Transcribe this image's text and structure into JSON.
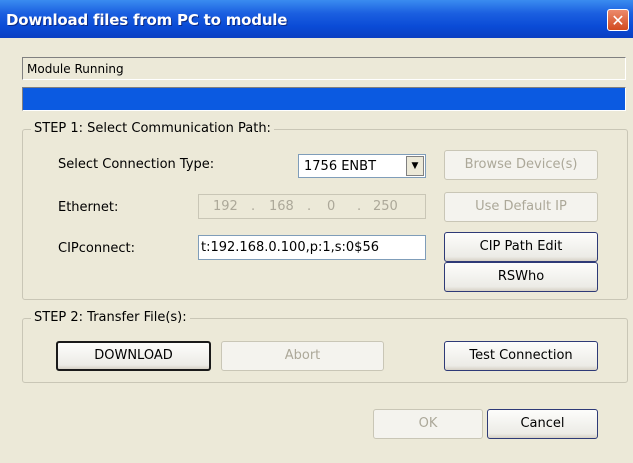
{
  "window": {
    "title": "Download files from PC to module",
    "close": "✕"
  },
  "status": {
    "text": "Module Running",
    "progress": 1.0
  },
  "step1": {
    "title": "STEP 1: Select Communication Path:",
    "connection_type_label": "Select Connection Type:",
    "connection_type_value": "1756 ENBT",
    "dropdown_arrow": "▼",
    "browse_device": "Browse Device(s)",
    "ethernet_label": "Ethernet:",
    "ip": [
      "192",
      "168",
      "0",
      "250"
    ],
    "ip_dot": ".",
    "use_default_ip": "Use Default IP",
    "cipconnect_label": "CIPconnect:",
    "cipconnect_value": "t:192.168.0.100,p:1,s:0$56",
    "cip_path_edit": "CIP Path Edit",
    "rswho": "RSWho"
  },
  "step2": {
    "title": "STEP 2: Transfer File(s):",
    "download": "DOWNLOAD",
    "abort": "Abort",
    "test_connection": "Test Connection"
  },
  "footer": {
    "ok": "OK",
    "cancel": "Cancel"
  }
}
